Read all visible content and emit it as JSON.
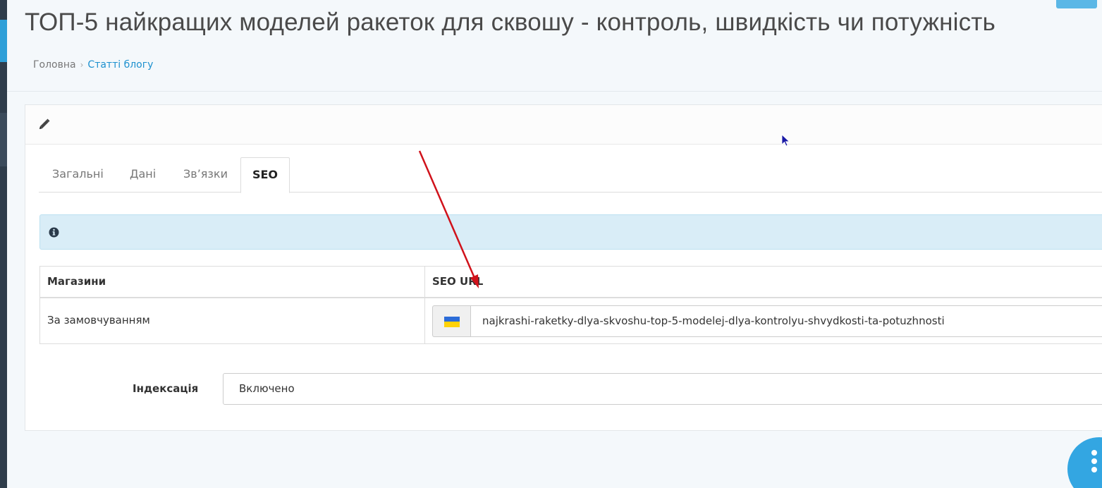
{
  "page": {
    "title": "ТОП-5 найкращих моделей ракеток для сквошу - контроль, швидкість чи потужність"
  },
  "breadcrumb": {
    "home": "Головна",
    "separator": "›",
    "current": "Статті блогу"
  },
  "panel": {
    "heading_icon": "pencil-icon",
    "tabs": [
      {
        "label": "Загальні",
        "active": false
      },
      {
        "label": "Дані",
        "active": false
      },
      {
        "label": "Зв’язки",
        "active": false
      },
      {
        "label": "SEO",
        "active": true
      }
    ],
    "alert_icon": "info-circle-icon",
    "alert_text": ""
  },
  "seo_table": {
    "headers": [
      "Магазини",
      "SEO URL"
    ],
    "rows": [
      {
        "store": "За замовчуванням",
        "flag_icon": "ukraine-flag-icon",
        "seo_url": "najkrashi-raketky-dlya-skvoshu-top-5-modelej-dlya-kontrolyu-shvydkosti-ta-potuzhnosti"
      }
    ]
  },
  "indexing": {
    "label": "Індексація",
    "value": "Включено"
  },
  "colors": {
    "accent": "#1e91cf",
    "fab": "#33a6e2",
    "alert_bg": "#d9edf7",
    "annotation_arrow": "#d0121b"
  }
}
